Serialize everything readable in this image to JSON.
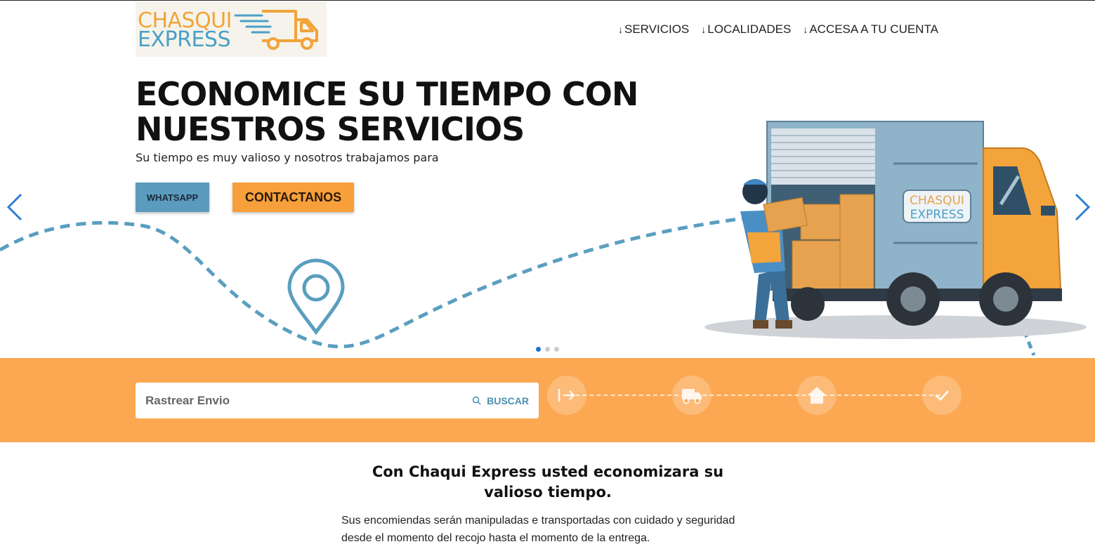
{
  "brand": {
    "line1": "CHASQUI",
    "line2": "EXPRESS"
  },
  "nav": [
    {
      "label": "SERVICIOS"
    },
    {
      "label": "LOCALIDADES"
    },
    {
      "label": "ACCESA A TU CUENTA"
    }
  ],
  "hero": {
    "title": "ECONOMICE SU TIEMPO CON NUESTROS SERVICIOS",
    "subtitle": "Su tiempo es muy valioso y nosotros trabajamos para",
    "whatsapp_label": "WHATSAPP",
    "contact_label": "CONTACTANOS",
    "truck_badge_line1": "CHASQUI",
    "truck_badge_line2": "EXPRESS"
  },
  "carousel": {
    "slides": 3,
    "active": 0
  },
  "tracking": {
    "placeholder": "Rastrear Envio",
    "search_label": "BUSCAR",
    "steps": [
      "arrow-right-to-line-icon",
      "truck-icon",
      "house-icon",
      "check-icon"
    ]
  },
  "info": {
    "title": "Con Chaqui Express usted economizara su valioso tiempo.",
    "body": "Sus encomiendas serán manipuladas e transportadas con cuidado y seguridad desde el momento del recojo hasta el momento de la entrega."
  },
  "colors": {
    "orange": "#fca852",
    "blue": "#5b9bbd",
    "accent_blue": "#1e6fe0"
  }
}
